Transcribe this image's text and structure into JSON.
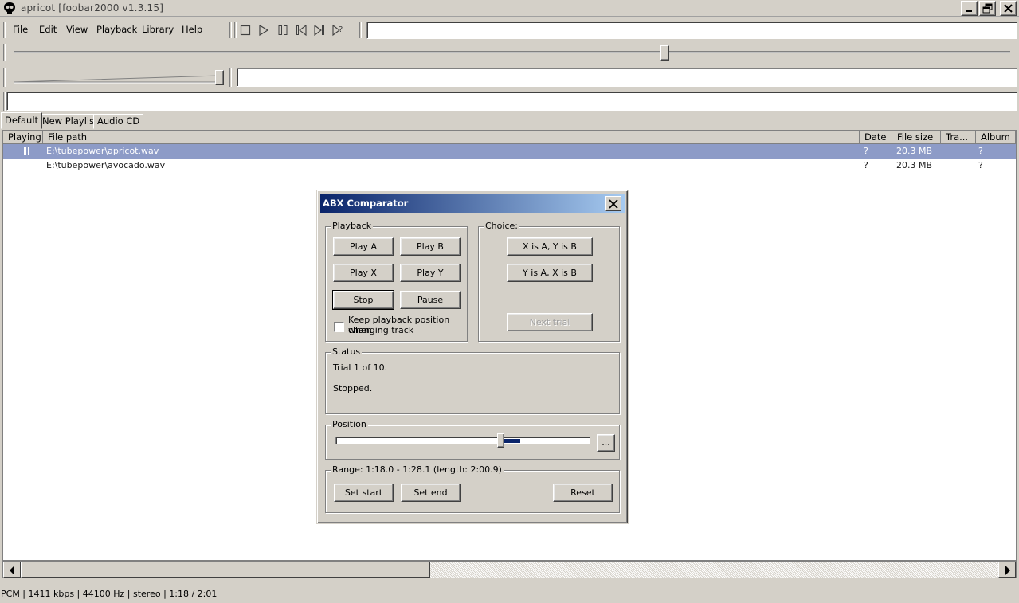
{
  "window": {
    "title": "apricot  [foobar2000 v1.3.15]",
    "controls": {
      "minimize": "minimize-icon",
      "restore": "restore-icon",
      "close": "close-icon"
    }
  },
  "menu": [
    "File",
    "Edit",
    "View",
    "Playback",
    "Library",
    "Help"
  ],
  "toolbar_icons": [
    "stop-icon",
    "play-icon",
    "pause-icon",
    "previous-icon",
    "next-icon",
    "random-icon"
  ],
  "seek_position": 0.653,
  "volume_level": 1.0,
  "tabs": [
    "Default",
    "New Playlist",
    "Audio CD"
  ],
  "active_tab": 0,
  "playlist": {
    "columns": [
      "Playing",
      "File path",
      "Date",
      "File size",
      "Tra...",
      "Album"
    ],
    "rows": [
      {
        "playing": "pause-icon",
        "path": "E:\\tubepower\\apricot.wav",
        "date": "?",
        "size": "20.3 MB",
        "track": "",
        "album": "?",
        "selected": true
      },
      {
        "playing": "",
        "path": "E:\\tubepower\\avocado.wav",
        "date": "?",
        "size": "20.3 MB",
        "track": "",
        "album": "?",
        "selected": false
      }
    ]
  },
  "status_bar": "PCM | 1411 kbps | 44100 Hz | stereo | 1:18 / 2:01",
  "dialog": {
    "title": "ABX Comparator",
    "playback": {
      "label": "Playback",
      "play_a": "Play A",
      "play_b": "Play B",
      "play_x": "Play X",
      "play_y": "Play Y",
      "stop": "Stop",
      "pause": "Pause",
      "keep_position_label_1": "Keep playback position when",
      "keep_position_label_2": "changing track",
      "keep_position_checked": false
    },
    "choice": {
      "label": "Choice:",
      "x_is_a": "X is A, Y is B",
      "y_is_a": "Y is A, X is B",
      "next_trial": "Next trial"
    },
    "status": {
      "label": "Status",
      "line1": "Trial 1 of 10.",
      "line2": "Stopped."
    },
    "position": {
      "label": "Position",
      "value": 0.648,
      "more_button": "...",
      "accent": "#0a246a"
    },
    "range": {
      "label": "Range: 1:18.0 - 1:28.1 (length: 2:00.9)",
      "set_start": "Set start",
      "set_end": "Set end",
      "reset": "Reset"
    }
  },
  "colors": {
    "face": "#d4d0c8",
    "selection": "#8d9bc7",
    "title_gradient_start": "#0a246a",
    "title_gradient_end": "#a6caf0"
  }
}
